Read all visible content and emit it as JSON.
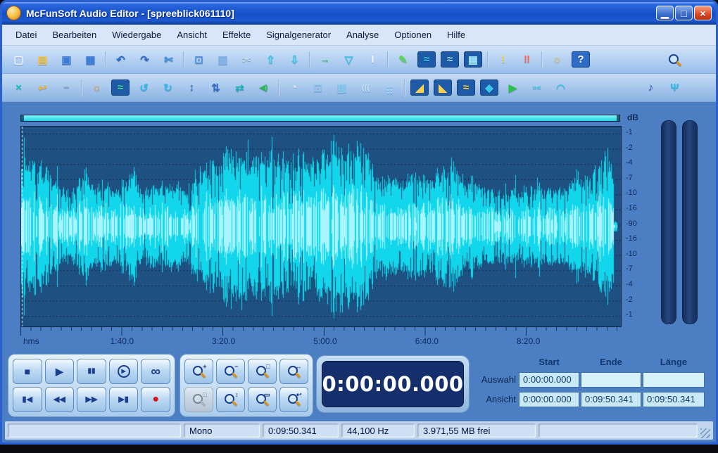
{
  "window": {
    "title": "McFunSoft Audio Editor - [spreeblick061110]",
    "buttons": [
      {
        "name": "minimize-button",
        "glyph": "▁"
      },
      {
        "name": "maximize-button",
        "glyph": "□"
      },
      {
        "name": "close-button",
        "glyph": "×"
      }
    ]
  },
  "menu": [
    "Datei",
    "Bearbeiten",
    "Wiedergabe",
    "Ansicht",
    "Effekte",
    "Signalgenerator",
    "Analyse",
    "Optionen",
    "Hilfe"
  ],
  "toolbar_row1": [
    {
      "name": "new-file-icon",
      "glyph": "▢",
      "color": "#F2F8FF"
    },
    {
      "name": "open-file-icon",
      "glyph": "▤",
      "color": "#F7C948"
    },
    {
      "name": "save-file-icon",
      "glyph": "▣",
      "color": "#3A7BD5"
    },
    {
      "name": "save-all-icon",
      "glyph": "▦",
      "color": "#3A7BD5"
    },
    {
      "sep": true
    },
    {
      "name": "undo-icon",
      "glyph": "↶",
      "color": "#2E6CC8"
    },
    {
      "name": "redo-icon",
      "glyph": "↷",
      "color": "#2E6CC8"
    },
    {
      "name": "trim-icon",
      "glyph": "✄",
      "color": "#4A90D9"
    },
    {
      "sep": true
    },
    {
      "name": "crop-icon",
      "glyph": "⊡",
      "color": "#4A90D9"
    },
    {
      "name": "copy-icon",
      "glyph": "▥",
      "color": "#7FB2E8"
    },
    {
      "name": "cut-icon",
      "glyph": "✂",
      "color": "#C0D8F0"
    },
    {
      "name": "paste-icon",
      "glyph": "⇧",
      "color": "#3AC8E8"
    },
    {
      "name": "paste-new-icon",
      "glyph": "⇩",
      "color": "#3AC8E8"
    },
    {
      "sep": true
    },
    {
      "name": "export-icon",
      "glyph": "→",
      "color": "#2FBF4F"
    },
    {
      "name": "filter-icon",
      "glyph": "▽",
      "color": "#3AC8E8"
    },
    {
      "name": "ibeam-cursor-icon",
      "glyph": "I",
      "color": "#F2F8FF"
    },
    {
      "sep": true
    },
    {
      "name": "mix-icon",
      "glyph": "✎",
      "color": "#58D858"
    },
    {
      "name": "wave-view-icon",
      "glyph": "≈",
      "color": "#35D0E8",
      "bg": "#1E5AA8"
    },
    {
      "name": "wave-multi-icon",
      "glyph": "≈",
      "color": "#9FE8FF",
      "bg": "#1E5AA8"
    },
    {
      "name": "wave-grid-icon",
      "glyph": "▦",
      "color": "#9FE8FF",
      "bg": "#1E5AA8"
    },
    {
      "sep": true
    },
    {
      "name": "normalize-warning-icon",
      "glyph": "!",
      "color": "#FFD34D"
    },
    {
      "name": "clip-warning-icon",
      "glyph": "‼",
      "color": "#FF6050"
    },
    {
      "sep": true
    },
    {
      "name": "audio-settings-icon",
      "glyph": "☼",
      "color": "#F7C948"
    },
    {
      "name": "help-icon",
      "glyph": "?",
      "color": "#FFFFFF",
      "bg": "#2E6CC8"
    },
    {
      "spacer": true
    },
    {
      "name": "search-magnifier-icon",
      "mag": true,
      "sub": ""
    }
  ],
  "toolbar_row2": [
    {
      "name": "swap-channels-icon",
      "glyph": "×",
      "color": "#18C0C0"
    },
    {
      "name": "undo-history-icon",
      "glyph": "↩",
      "color": "#E8B840"
    },
    {
      "name": "remove-icon",
      "glyph": "−",
      "color": "#90A8C0"
    },
    {
      "sep": true
    },
    {
      "name": "brightness-icon",
      "glyph": "☼",
      "color": "#F7A828"
    },
    {
      "name": "fit-selection-icon",
      "glyph": "≈",
      "color": "#40E090",
      "bg": "#1E5AA8"
    },
    {
      "name": "loop-once-icon",
      "glyph": "↺",
      "color": "#30B8E8"
    },
    {
      "name": "loop-continuous-icon",
      "glyph": "↻",
      "color": "#30B8E8"
    },
    {
      "name": "expand-vertical-icon",
      "glyph": "↕",
      "color": "#2E6CC8"
    },
    {
      "name": "shrink-vertical-icon",
      "glyph": "⇅",
      "color": "#2E6CC8"
    },
    {
      "name": "channel-swap-icon",
      "glyph": "⇄",
      "color": "#18B8B8"
    },
    {
      "name": "speaker-icon",
      "glyph": "◀)",
      "color": "#28B858"
    },
    {
      "sep": true
    },
    {
      "name": "stopwatch-icon",
      "glyph": "◔",
      "color": "#E8EEF8"
    },
    {
      "name": "zoom-frame-icon",
      "glyph": "⊡",
      "color": "#88C8F0"
    },
    {
      "name": "buffer-icon",
      "glyph": "▦",
      "color": "#88C8F0"
    },
    {
      "name": "sound-waves-icon",
      "glyph": "(((",
      "color": "#C8E4F8"
    },
    {
      "name": "spectrum-icon",
      "glyph": "⣶",
      "color": "#9FD8FF"
    },
    {
      "sep": true
    },
    {
      "name": "fade-in-icon",
      "glyph": "◢",
      "color": "#FFD34D",
      "bg": "#1E5AA8"
    },
    {
      "name": "fade-out-icon",
      "glyph": "◣",
      "color": "#FFD34D",
      "bg": "#1E5AA8"
    },
    {
      "name": "envelope-icon",
      "glyph": "≈",
      "color": "#FFD34D",
      "bg": "#1E5AA8"
    },
    {
      "name": "dynamics-icon",
      "glyph": "◆",
      "color": "#3AC8E8",
      "bg": "#1E5AA8"
    },
    {
      "name": "preview-icon",
      "glyph": "▶",
      "color": "#2FBF4F"
    },
    {
      "name": "compress-icon",
      "glyph": "»«",
      "color": "#3AC8E8"
    },
    {
      "name": "smooth-icon",
      "glyph": "◠",
      "color": "#3AC8E8"
    },
    {
      "spacer": true
    },
    {
      "name": "music-note-icon",
      "glyph": "♪",
      "color": "#3858C8"
    },
    {
      "name": "pitch-icon",
      "glyph": "Ψ",
      "color": "#30B8E8"
    }
  ],
  "wave": {
    "db_unit": "dB",
    "db_labels": [
      "-1",
      "-2",
      "-4",
      "-7",
      "-10",
      "-16",
      "-90",
      "-16",
      "-10",
      "-7",
      "-4",
      "-2",
      "-1"
    ],
    "ruler_origin": "hms",
    "ruler_marks": [
      {
        "label": "1:40.0",
        "sec": 100
      },
      {
        "label": "3:20.0",
        "sec": 200
      },
      {
        "label": "5:00.0",
        "sec": 300
      },
      {
        "label": "6:40.0",
        "sec": 400
      },
      {
        "label": "8:20.0",
        "sec": 500
      }
    ],
    "total_seconds": 590.341
  },
  "transport": {
    "row1": [
      {
        "name": "stop-button",
        "glyph": "■"
      },
      {
        "name": "play-button",
        "glyph": "▶"
      },
      {
        "name": "pause-button",
        "glyph": "▮▮",
        "size": 10
      },
      {
        "name": "play-circle-button",
        "glyph": "▶",
        "circle": true
      },
      {
        "name": "loop-button",
        "glyph": "∞",
        "size": 19
      }
    ],
    "row2": [
      {
        "name": "skip-start-button",
        "glyph": "▮◀",
        "size": 11
      },
      {
        "name": "rewind-button",
        "glyph": "◀◀",
        "size": 11
      },
      {
        "name": "fast-forward-button",
        "glyph": "▶▶",
        "size": 11
      },
      {
        "name": "skip-end-button",
        "glyph": "▶▮",
        "size": 11
      },
      {
        "name": "record-button",
        "glyph": "●",
        "color": "#D81818",
        "size": 16
      }
    ]
  },
  "zoom": {
    "row1": [
      {
        "name": "zoom-in-button",
        "mag": true,
        "sub": "+"
      },
      {
        "name": "zoom-out-button",
        "mag": true,
        "sub": "−"
      },
      {
        "name": "zoom-selection-button",
        "mag": true,
        "sub": "□"
      },
      {
        "name": "zoom-all-button",
        "mag": true,
        "sub": "↔"
      }
    ],
    "row2": [
      {
        "name": "zoom-window-button",
        "mag": true,
        "sub": "□",
        "disabled": true
      },
      {
        "name": "zoom-vertical-button",
        "mag": true,
        "sub": "↕"
      },
      {
        "name": "zoom-horizontal-button",
        "mag": true,
        "sub": "▭"
      },
      {
        "name": "zoom-previous-button",
        "mag": true,
        "sub": "↩"
      }
    ]
  },
  "time_display": "0:00:00.000",
  "selection": {
    "headers": [
      "Start",
      "Ende",
      "Länge"
    ],
    "rows": [
      {
        "label": "Auswahl",
        "cells": [
          "0:00:00.000",
          "",
          ""
        ]
      },
      {
        "label": "Ansicht",
        "cells": [
          "0:00:00.000",
          "0:09:50.341",
          "0:09:50.341"
        ]
      }
    ]
  },
  "status": {
    "channel": "Mono",
    "length": "0:09:50.341",
    "samplerate": "44,100 Hz",
    "free_space": "3.971,55 MB frei"
  },
  "colors": {
    "waveform": "#12D6EC",
    "waveform_bg": "#1F5082",
    "accent_cyan": "#40E8F0",
    "record_red": "#D81818",
    "title_blue": "#1450C8"
  }
}
